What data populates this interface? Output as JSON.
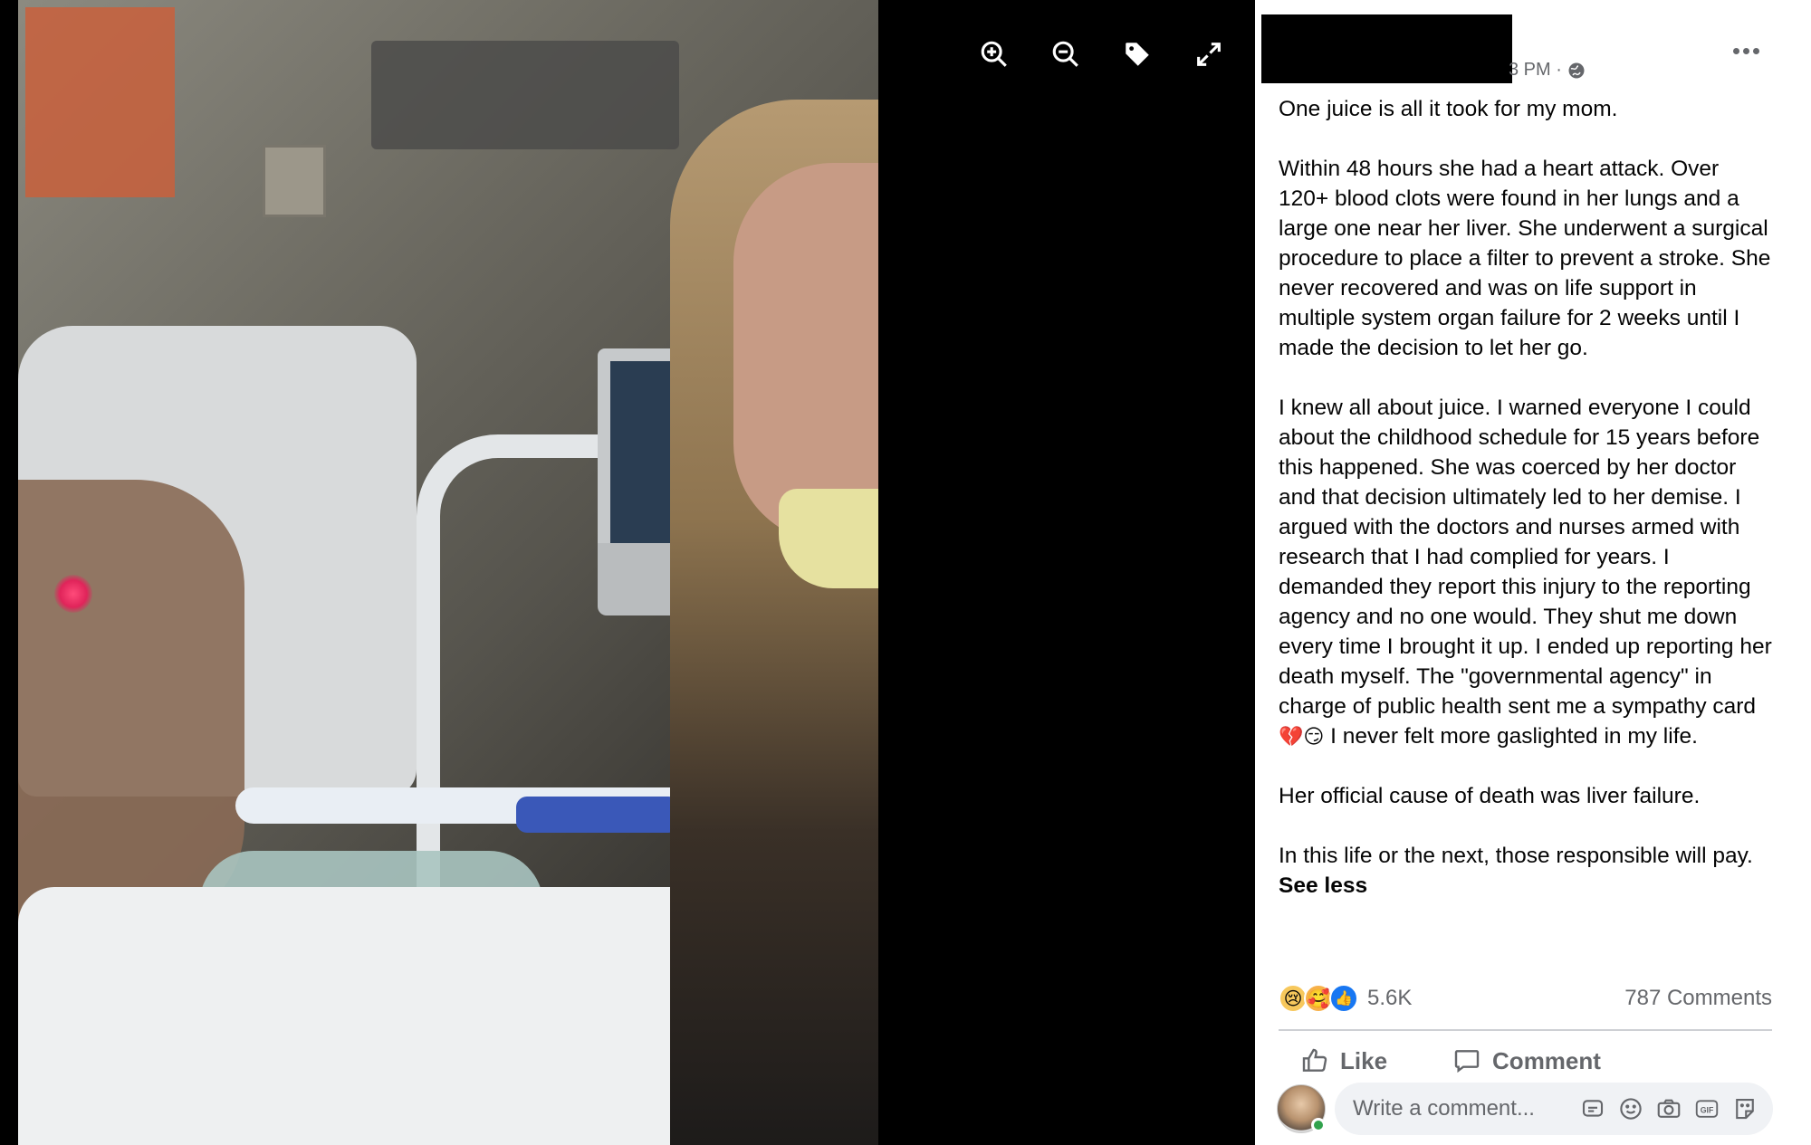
{
  "viewer": {
    "toolbar": [
      {
        "icon": "zoom-in-icon"
      },
      {
        "icon": "zoom-out-icon"
      },
      {
        "icon": "tag-icon"
      },
      {
        "icon": "fullscreen-icon"
      }
    ]
  },
  "post": {
    "time_fragment": "3 PM ·",
    "privacy_icon": "globe-icon",
    "paragraphs": [
      "One juice is all it took for my mom.",
      "Within 48 hours she had a heart attack. Over 120+ blood clots were found in her lungs and a large one near her liver. She underwent a surgical procedure to place a filter to prevent a stroke. She never recovered and was on life support in multiple system organ failure for 2 weeks until I made the decision to let her go.",
      "I knew all about juice. I warned everyone I could about the childhood schedule for 15 years before this happened. She was coerced by her doctor and that decision ultimately led to her demise. I argued with the doctors and nurses armed with research that I had complied for years. I demanded they report this injury to the reporting agency and no one would. They shut me down every time I brought it up. I ended up reporting her death myself. The \"governmental agency\" in charge of public health sent me a sympathy card",
      "I never felt more gaslighted in my life.",
      "Her official cause of death was liver failure.",
      "In this life or the next, those responsible will pay."
    ],
    "inline_emojis": "💔😏",
    "see_less": "See less"
  },
  "engagement": {
    "reactions": [
      "sad",
      "care",
      "like"
    ],
    "reaction_count": "5.6K",
    "comments_count": "787 Comments",
    "like_label": "Like",
    "comment_label": "Comment"
  },
  "composer": {
    "placeholder": "Write a comment...",
    "tools": [
      "sticker-icon",
      "emoji-icon",
      "camera-icon",
      "gif-icon",
      "avatar-sticker-icon"
    ]
  },
  "colors": {
    "secondary_text": "#65676b",
    "like_blue": "#1877f2",
    "online_green": "#31a24c"
  }
}
